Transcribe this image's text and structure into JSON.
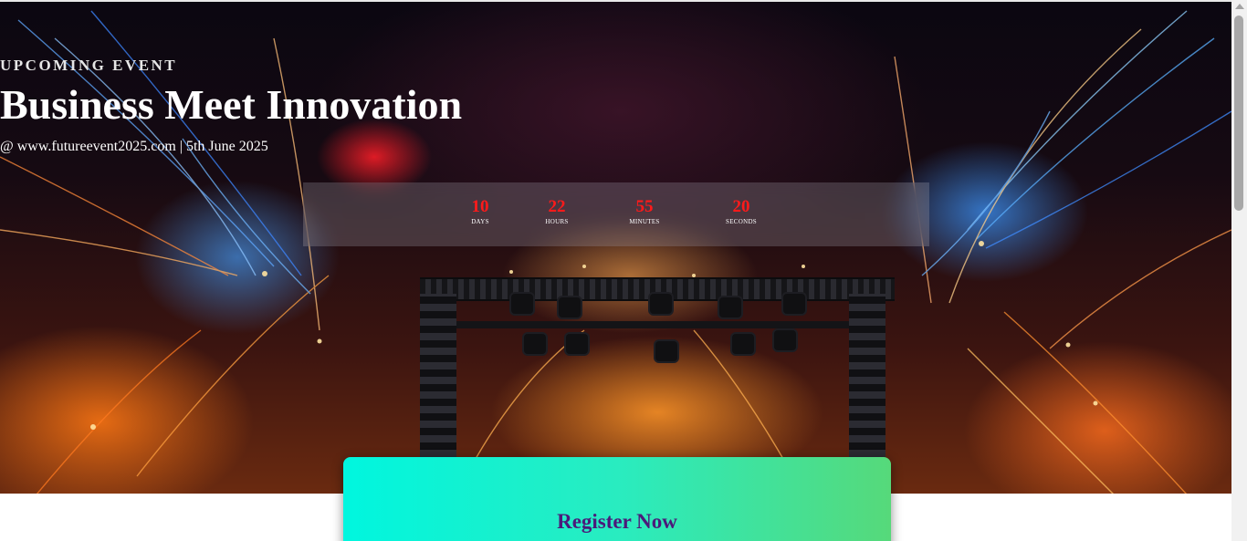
{
  "hero": {
    "eyebrow": "UPCOMING EVENT",
    "title": "Business Meet Innovation",
    "subline": "@ www.futureevent2025.com | 5th June 2025"
  },
  "countdown": {
    "units": [
      {
        "value": "10",
        "label": "DAYS"
      },
      {
        "value": "22",
        "label": "HOURS"
      },
      {
        "value": "55",
        "label": "MINUTES"
      },
      {
        "value": "20",
        "label": "SECONDS"
      }
    ]
  },
  "register": {
    "label": "Register Now"
  },
  "colors": {
    "countdown_number": "#ff1a1a",
    "register_text": "#4b1a7a",
    "register_gradient_start": "#00f6df",
    "register_gradient_end": "#56d97a"
  }
}
